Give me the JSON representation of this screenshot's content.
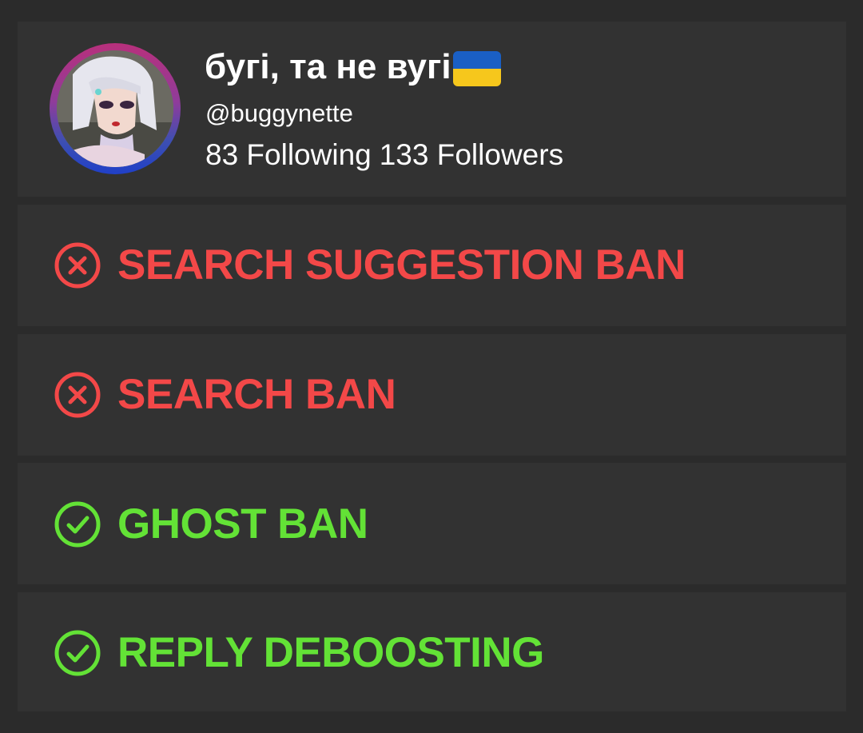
{
  "profile": {
    "display_name": "бугі, та не вугі",
    "flag_icon": "ukraine-flag-icon",
    "handle": "@buggynette",
    "following": "83 Following",
    "followers": "133 Followers"
  },
  "colors": {
    "background": "#2b2b2b",
    "card": "#323232",
    "banned": "#f34848",
    "ok": "#63e236"
  },
  "checks": [
    {
      "label": "SEARCH SUGGESTION BAN",
      "status": "banned",
      "icon": "x-circle-icon"
    },
    {
      "label": "SEARCH BAN",
      "status": "banned",
      "icon": "x-circle-icon"
    },
    {
      "label": "GHOST BAN",
      "status": "ok",
      "icon": "check-circle-icon"
    },
    {
      "label": "REPLY DEBOOSTING",
      "status": "ok",
      "icon": "check-circle-icon"
    }
  ]
}
